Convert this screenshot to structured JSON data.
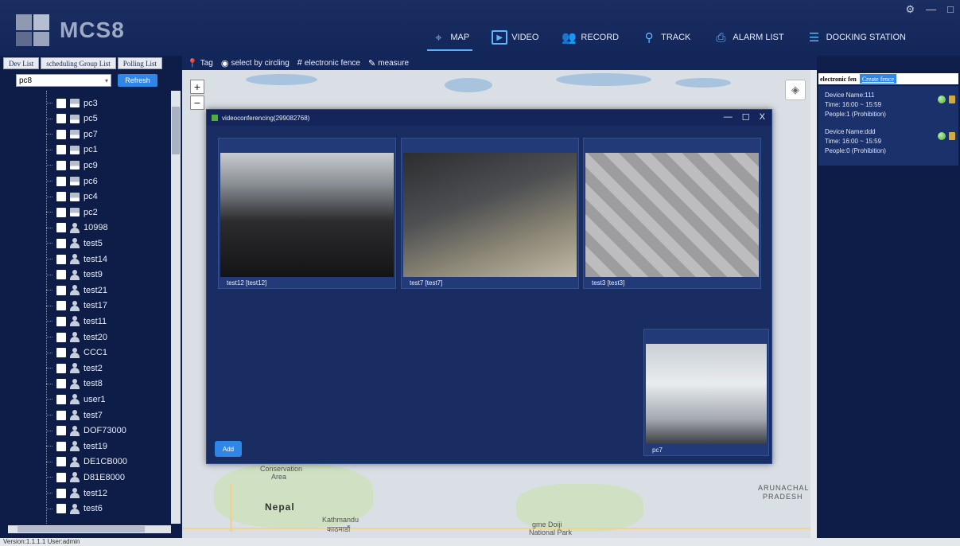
{
  "app": {
    "title": "MCS8",
    "window_controls": [
      "⚙",
      "—",
      "□"
    ]
  },
  "nav": {
    "items": [
      {
        "label": "MAP",
        "icon": "map-pin-icon",
        "active": true
      },
      {
        "label": "VIDEO",
        "icon": "play-icon"
      },
      {
        "label": "RECORD",
        "icon": "users-icon"
      },
      {
        "label": "TRACK",
        "icon": "location-icon"
      },
      {
        "label": "ALARM LIST",
        "icon": "camera-icon"
      },
      {
        "label": "DOCKING STATION",
        "icon": "database-icon"
      }
    ]
  },
  "left_panel": {
    "tabs": [
      "Dev List",
      "scheduling Group List",
      "Polling List"
    ],
    "filter_value": "pc8",
    "refresh_label": "Refresh",
    "devices": [
      {
        "name": "pc3",
        "type": "pc"
      },
      {
        "name": "pc5",
        "type": "pc"
      },
      {
        "name": "pc7",
        "type": "pc"
      },
      {
        "name": "pc1",
        "type": "pc"
      },
      {
        "name": "pc9",
        "type": "pc"
      },
      {
        "name": "pc6",
        "type": "pc"
      },
      {
        "name": "pc4",
        "type": "pc"
      },
      {
        "name": "pc2",
        "type": "pc"
      },
      {
        "name": "10998",
        "type": "user"
      },
      {
        "name": "test5",
        "type": "user"
      },
      {
        "name": "test14",
        "type": "user"
      },
      {
        "name": "test9",
        "type": "user"
      },
      {
        "name": "test21",
        "type": "user"
      },
      {
        "name": "test17",
        "type": "user"
      },
      {
        "name": "test11",
        "type": "user"
      },
      {
        "name": "test20",
        "type": "user"
      },
      {
        "name": "CCC1",
        "type": "user"
      },
      {
        "name": "test2",
        "type": "user"
      },
      {
        "name": "test8",
        "type": "user"
      },
      {
        "name": "user1",
        "type": "user"
      },
      {
        "name": "test7",
        "type": "user"
      },
      {
        "name": "DOF73000",
        "type": "user"
      },
      {
        "name": "test19",
        "type": "user"
      },
      {
        "name": "DE1CB000",
        "type": "user"
      },
      {
        "name": "D81E8000",
        "type": "user"
      },
      {
        "name": "test12",
        "type": "user"
      },
      {
        "name": "test6",
        "type": "user"
      }
    ]
  },
  "map_toolbar": {
    "tools": [
      {
        "label": "Tag",
        "icon": "pin-icon"
      },
      {
        "label": "select by circling",
        "icon": "circle-select-icon"
      },
      {
        "label": "electronic fence",
        "icon": "fence-icon"
      },
      {
        "label": "measure",
        "icon": "ruler-icon"
      }
    ]
  },
  "map": {
    "labels": {
      "nepal": "Nepal",
      "kathmandu": "Kathmandu",
      "kathmandu_local": "काठमाडौं",
      "conservation": "Conservation",
      "area": "Area",
      "arunachal": "ARUNACHAL",
      "pradesh": "PRADESH",
      "park": "gme Doiji",
      "park2": "National Park"
    }
  },
  "right_panel": {
    "header": "electronic fen",
    "create_label": "Create fence",
    "fences": [
      {
        "device": "Device Name:111",
        "time": "Time:  16:00 ~ 15:59",
        "people": "People:1  (Prohibition)"
      },
      {
        "device": "Device Name:ddd",
        "time": "Time:  16:00 ~ 15:59",
        "people": "People:0  (Prohibition)"
      }
    ]
  },
  "dialog": {
    "title": "videoconferencing(299082768)",
    "controls": [
      "—",
      "☐",
      "X"
    ],
    "tiles": [
      {
        "label": "test12 [test12]"
      },
      {
        "label": "test7 [test7]"
      },
      {
        "label": "test3 [test3]"
      },
      {
        "label": "pc7"
      }
    ],
    "add_label": "Add"
  },
  "status": {
    "text": "Version:1.1.1.1  User:admin"
  }
}
